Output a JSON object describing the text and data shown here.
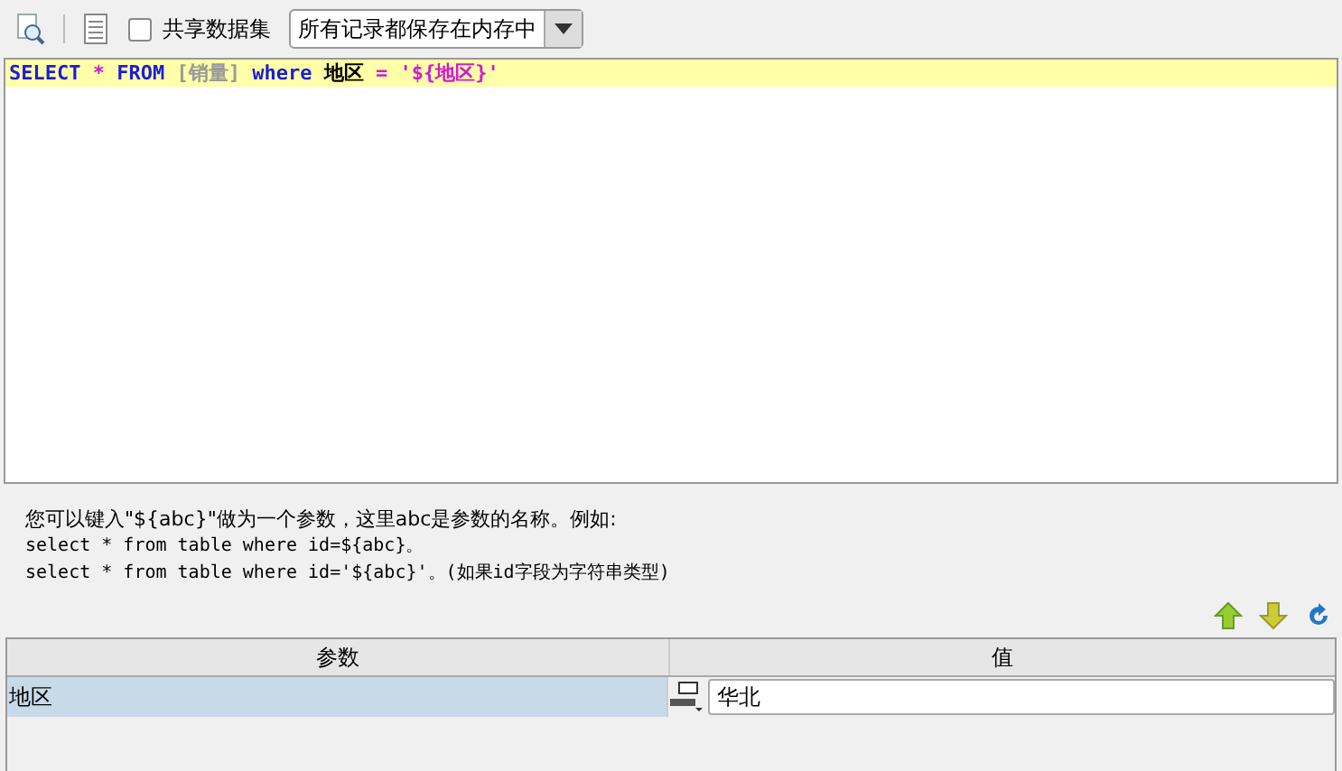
{
  "toolbar": {
    "shared_dataset": {
      "label": "共享数据集",
      "checked": false
    },
    "storage_mode": {
      "value": "所有记录都保存在内存中"
    }
  },
  "sql_editor": {
    "tokens": [
      {
        "kind": "keyword",
        "text": "SELECT"
      },
      {
        "kind": "operator",
        "text": "*"
      },
      {
        "kind": "keyword",
        "text": "FROM"
      },
      {
        "kind": "table",
        "text": "[销量]"
      },
      {
        "kind": "keyword",
        "text": "where"
      },
      {
        "kind": "ident",
        "text": "地区"
      },
      {
        "kind": "operator",
        "text": "="
      },
      {
        "kind": "string",
        "text": "'${地区}'"
      }
    ]
  },
  "hint": {
    "lines": [
      "您可以键入\"${abc}\"做为一个参数，这里abc是参数的名称。例如:",
      "select * from table where id=${abc}。",
      "select * from table where id='${abc}'。(如果id字段为字符串类型)"
    ]
  },
  "parameters": {
    "columns": [
      "参数",
      "值"
    ],
    "rows": [
      {
        "name": "地区",
        "value": "华北",
        "selected": true
      }
    ]
  }
}
